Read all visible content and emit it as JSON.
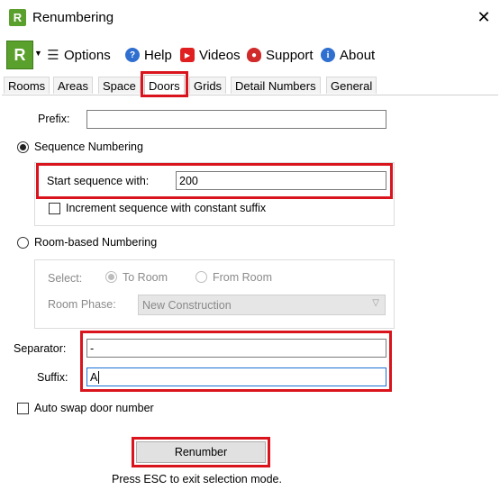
{
  "window": {
    "icon_letter": "R",
    "title": "Renumbering",
    "close_glyph": "✕"
  },
  "toolbar": {
    "logo_letter": "R",
    "dropdown_glyph": "▼",
    "items": [
      {
        "label": "Options",
        "icon": "list-icon"
      },
      {
        "label": "Help",
        "icon": "help-icon"
      },
      {
        "label": "Videos",
        "icon": "video-play-icon"
      },
      {
        "label": "Support",
        "icon": "support-headset-icon"
      },
      {
        "label": "About",
        "icon": "info-icon"
      }
    ]
  },
  "tabs": [
    {
      "label": "Rooms"
    },
    {
      "label": "Areas"
    },
    {
      "label": "Space"
    },
    {
      "label": "Doors",
      "active": true
    },
    {
      "label": "Grids"
    },
    {
      "label": "Detail Numbers"
    },
    {
      "label": "General"
    }
  ],
  "form": {
    "prefix_label": "Prefix:",
    "prefix_value": "",
    "sequence_radio_label": "Sequence Numbering",
    "start_sequence_label": "Start sequence with:",
    "start_sequence_value": "200",
    "increment_checkbox_label": "Increment sequence with constant suffix",
    "room_based_radio_label": "Room-based Numbering",
    "select_label": "Select:",
    "to_room_label": "To Room",
    "from_room_label": "From Room",
    "room_phase_label": "Room Phase:",
    "room_phase_value": "New Construction",
    "separator_label": "Separator:",
    "separator_value": "-",
    "suffix_label": "Suffix:",
    "suffix_value": "A",
    "auto_swap_label": "Auto swap door number",
    "renumber_button": "Renumber",
    "status_text": "Press ESC to exit selection mode."
  },
  "colors": {
    "highlight": "#d9141c",
    "brand": "#5aa02c"
  }
}
